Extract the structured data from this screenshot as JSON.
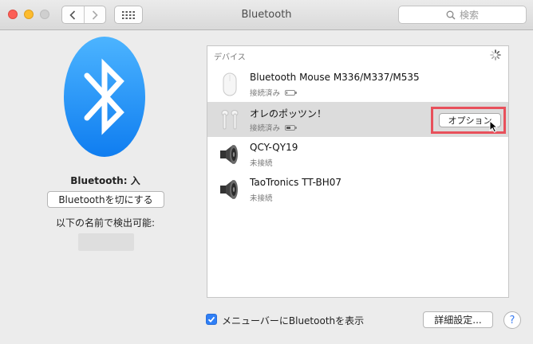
{
  "window": {
    "title": "Bluetooth"
  },
  "toolbar": {
    "back_icon": "chevron-left-icon",
    "forward_icon": "chevron-right-icon",
    "grid_icon": "show-all-grid-icon",
    "search_placeholder": "検索"
  },
  "bluetooth": {
    "status": "Bluetooth: 入",
    "toggle_label": "Bluetoothを切にする",
    "discover_label": "以下の名前で検出可能:",
    "accent_color": "#1e90ff"
  },
  "devices": {
    "header": "デバイス",
    "items": [
      {
        "name": "Bluetooth Mouse M336/M337/M535",
        "status": "接続済み",
        "icon": "magic-mouse-icon",
        "battery": 0.1
      },
      {
        "name": "オレのポッツン！",
        "status": "接続済み",
        "icon": "airpods-icon",
        "battery": 0.5,
        "button": "オプション"
      },
      {
        "name": "QCY-QY19",
        "status": "未接続",
        "icon": "speaker-icon"
      },
      {
        "name": "TaoTronics TT-BH07",
        "status": "未接続",
        "icon": "speaker-icon"
      }
    ]
  },
  "footer": {
    "menu_bar_label": "メニューバーにBluetoothを表示",
    "menu_bar_checked": true,
    "advanced_label": "詳細設定...",
    "help_label": "?"
  },
  "highlight_color": "#e8505b"
}
